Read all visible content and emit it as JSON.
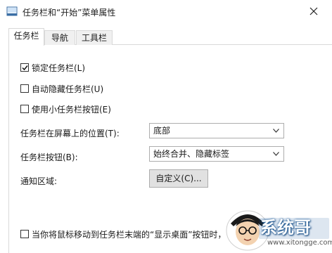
{
  "window": {
    "title": "任务栏和“开始”菜单属性"
  },
  "tabs": [
    {
      "label": "任务栏",
      "active": true
    },
    {
      "label": "导航",
      "active": false
    },
    {
      "label": "工具栏",
      "active": false
    }
  ],
  "options": {
    "lock_taskbar": {
      "label": "锁定任务栏(L)",
      "checked": true
    },
    "auto_hide": {
      "label": "自动隐藏任务栏(U)",
      "checked": false
    },
    "small_buttons": {
      "label": "使用小任务栏按钮(E)",
      "checked": false
    }
  },
  "location": {
    "label": "任务栏在屏幕上的位置(T):",
    "value": "底部"
  },
  "buttons_setting": {
    "label": "任务栏按钮(B):",
    "value": "始终合并、隐藏标签"
  },
  "notification": {
    "label": "通知区域:",
    "button_label": "自定义(C)..."
  },
  "peek": {
    "label": "当你将鼠标移动到任务栏末端的“显示桌面”按钮时，",
    "checked": false
  },
  "watermark": {
    "brand": "系统哥",
    "url": "www.xitongge.com"
  },
  "icons": {
    "app": "taskbar-icon",
    "close": "close-icon",
    "check": "checkmark-icon",
    "dropdown": "chevron-down-icon",
    "mascot": "mascot-icon"
  },
  "colors": {
    "tab_border": "#d9d9d9",
    "button_bg": "#e1e1e1",
    "brand_blue": "#1a5a9a"
  }
}
